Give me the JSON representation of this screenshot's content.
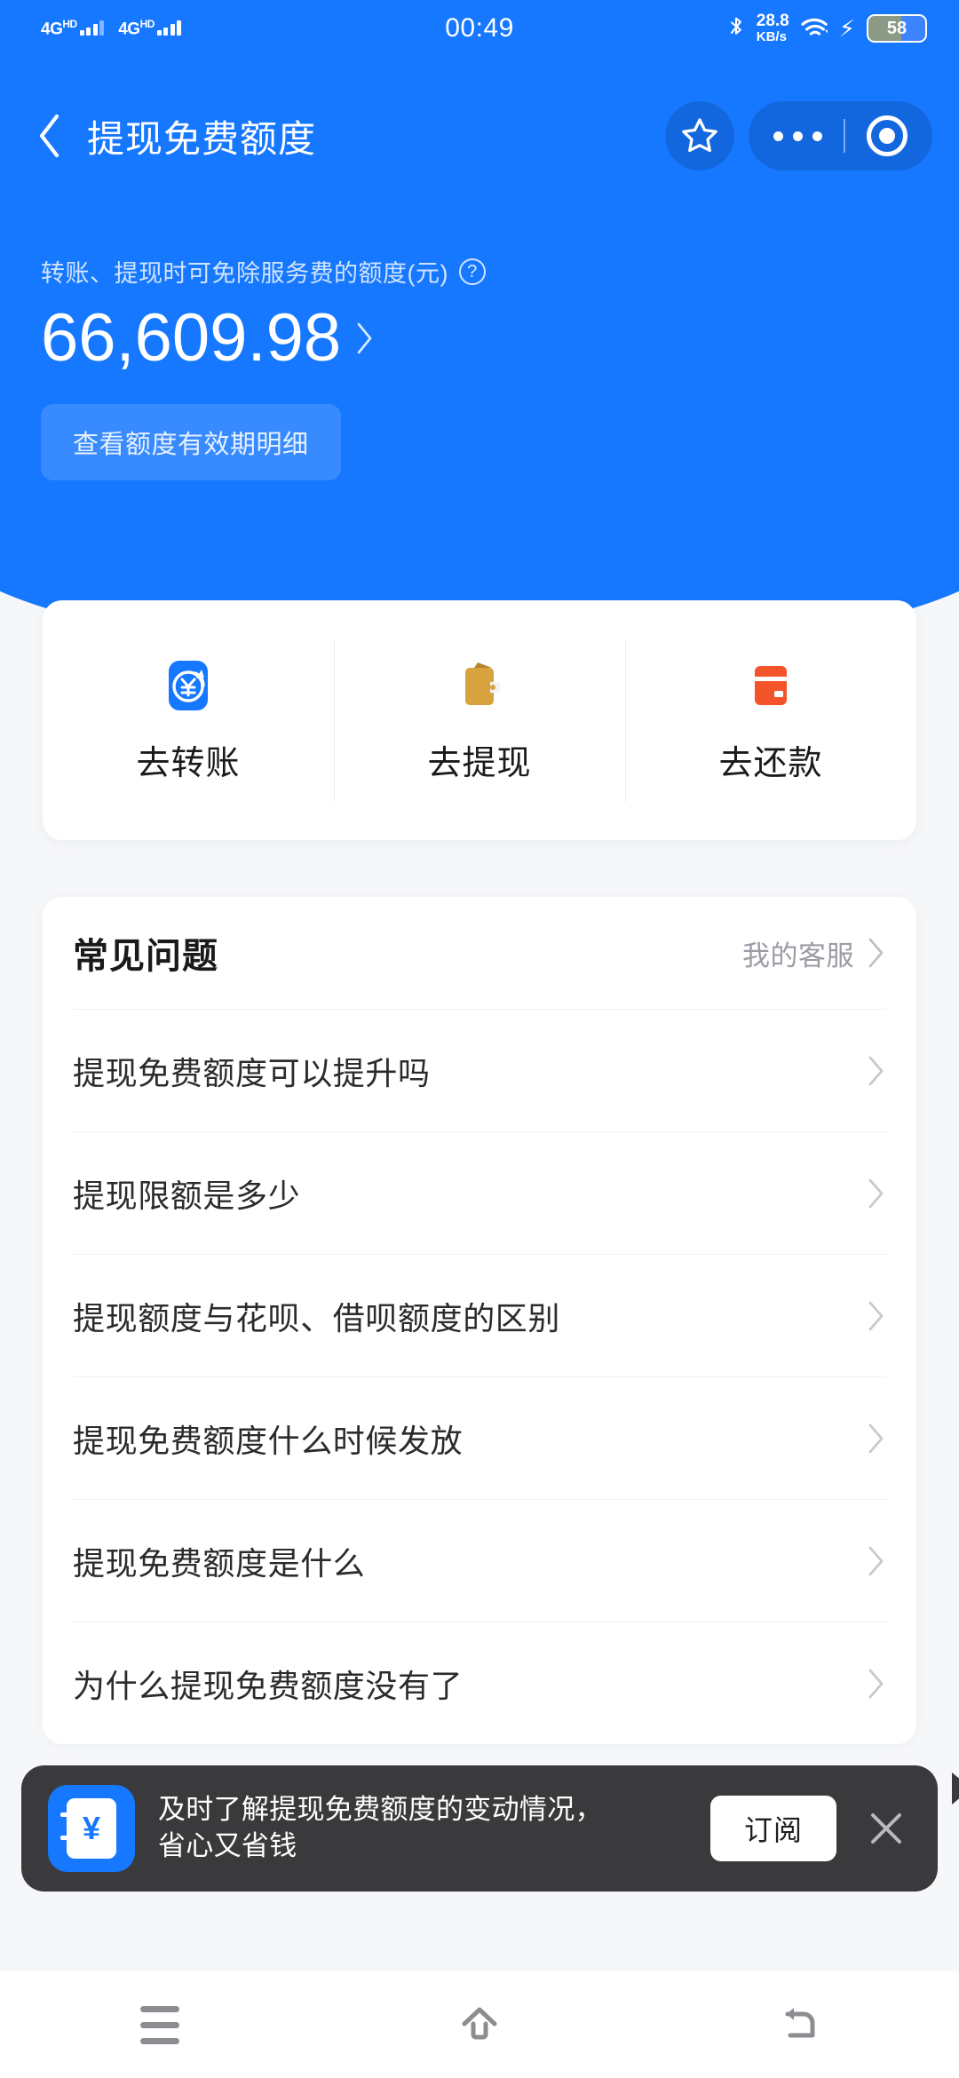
{
  "statusbar": {
    "network_label_1": "4G",
    "network_sup_1": "HD",
    "network_label_2": "4G",
    "network_sup_2": "HD",
    "time": "00:49",
    "netspeed_value": "28.8",
    "netspeed_unit": "KB/s",
    "battery_percent": "58",
    "bluetooth_icon": "bluetooth-icon",
    "wifi_icon": "wifi-icon",
    "charging_icon": "charging-bolt-icon"
  },
  "header": {
    "title": "提现免费额度",
    "back_icon": "back-chevron-icon",
    "favorite_icon": "star-icon",
    "more_icon": "more-dots-icon",
    "target_icon": "target-circle-icon"
  },
  "hero": {
    "label": "转账、提现时可免除服务费的额度(元)",
    "help_icon": "question-mark-icon",
    "amount": "66,609.98",
    "amount_chevron_icon": "chevron-right-icon",
    "detail_pill": "查看额度有效期明细",
    "background_color": "#1677ff"
  },
  "actions": {
    "items": [
      {
        "label": "去转账",
        "icon": "transfer-yen-icon",
        "color": "#1677ff"
      },
      {
        "label": "去提现",
        "icon": "wallet-icon",
        "color": "#d8a33f"
      },
      {
        "label": "去还款",
        "icon": "credit-card-icon",
        "color": "#f4542a"
      }
    ]
  },
  "faq": {
    "title": "常见问题",
    "service_link": "我的客服",
    "service_chevron_icon": "chevron-right-icon",
    "items": [
      {
        "text": "提现免费额度可以提升吗"
      },
      {
        "text": "提现限额是多少"
      },
      {
        "text": "提现额度与花呗、借呗额度的区别"
      },
      {
        "text": "提现免费额度什么时候发放"
      },
      {
        "text": "提现免费额度是什么"
      },
      {
        "text": "为什么提现免费额度没有了"
      }
    ]
  },
  "toast": {
    "icon": "ledger-yen-icon",
    "icon_symbol": "¥",
    "message": "及时了解提现免费额度的变动情况，省心又省钱",
    "button_label": "订阅",
    "close_icon": "close-icon",
    "background_color": "#3a3a3c"
  },
  "systemnav": {
    "recents_icon": "recents-icon",
    "home_icon": "home-icon",
    "back_icon": "back-arrow-icon"
  }
}
